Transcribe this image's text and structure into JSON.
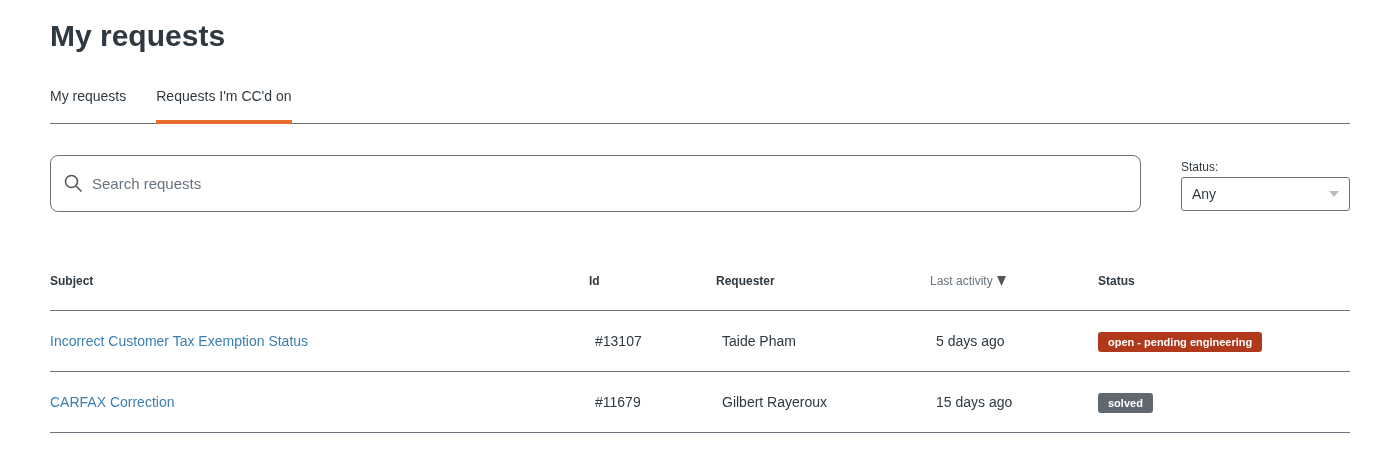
{
  "page": {
    "title": "My requests"
  },
  "tabs": [
    {
      "label": "My requests",
      "selected": false
    },
    {
      "label": "Requests I'm CC'd on",
      "selected": true
    }
  ],
  "search": {
    "placeholder": "Search requests"
  },
  "status_filter": {
    "label": "Status:",
    "value": "Any"
  },
  "table": {
    "columns": [
      {
        "label": "Subject",
        "sorted": false
      },
      {
        "label": "Id",
        "sorted": false
      },
      {
        "label": "Requester",
        "sorted": false
      },
      {
        "label": "Last activity",
        "sorted": true
      },
      {
        "label": "Status",
        "sorted": false
      }
    ],
    "rows": [
      {
        "subject": "Incorrect Customer Tax Exemption Status",
        "id": "#13107",
        "requester": "Taide Pham",
        "last_activity": "5 days ago",
        "status": {
          "label": "open - pending engineering",
          "color": "#b0381b"
        }
      },
      {
        "subject": "CARFAX Correction",
        "id": "#11679",
        "requester": "Gilbert Rayeroux",
        "last_activity": "15 days ago",
        "status": {
          "label": "solved",
          "color": "#5f6871"
        }
      }
    ]
  }
}
